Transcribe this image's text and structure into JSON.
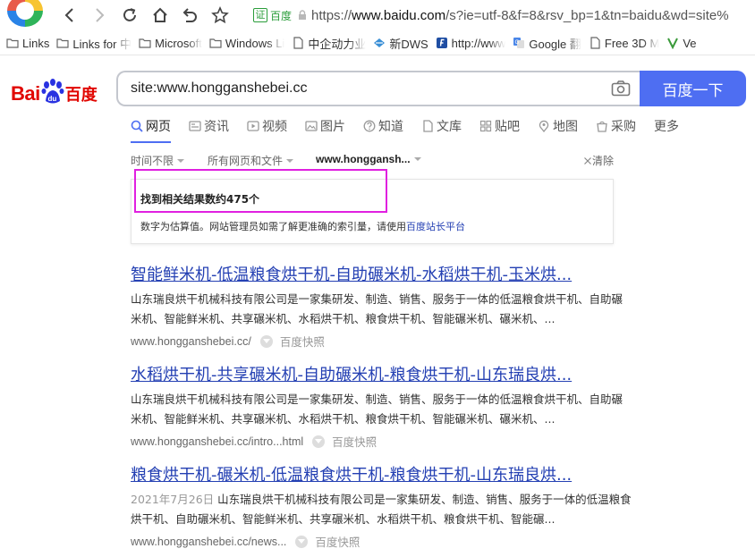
{
  "browser": {
    "cert_label": "证 百度",
    "url_prefix": "https://",
    "url_host": "www.baidu.com",
    "url_rest": "/s?ie=utf-8&f=8&rsv_bp=1&tn=baidu&wd=site%"
  },
  "bookmarks": [
    "Links",
    "Links for 中",
    "Microsoft",
    "Windows Li",
    "中企动力业",
    "新DWS",
    "http://www",
    "Google 翻",
    "Free 3D M",
    "Ve"
  ],
  "header": {
    "logo_text": "Bai",
    "logo_du": "du",
    "logo_cn": "百度",
    "search_value": "site:www.hongganshebei.cc",
    "search_button": "百度一下"
  },
  "tabs": [
    "网页",
    "资讯",
    "视频",
    "图片",
    "知道",
    "文库",
    "贴吧",
    "地图",
    "采购",
    "更多"
  ],
  "filters": {
    "time": "时间不限",
    "type": "所有网页和文件",
    "site": "www.hongganshebei.cc",
    "site_display": "www.honggansh...",
    "clear": "清除"
  },
  "count_panel": {
    "title": "找到相关结果数约475个",
    "note_prefix": "数字为估算值。网站管理员如需了解更准确的索引量，请使用",
    "note_link": "百度站长平台"
  },
  "results": [
    {
      "title": "智能鲜米机-低温粮食烘干机-自助碾米机-水稻烘干机-玉米烘...",
      "date": "",
      "abstract": "山东瑞良烘干机械科技有限公司是一家集研发、制造、销售、服务于一体的低温粮食烘干机、自助碾米机、智能鲜米机、共享碾米机、水稻烘干机、粮食烘干机、智能碾米机、碾米机、...",
      "url": "www.hongganshebei.cc/",
      "snapshot": "百度快照"
    },
    {
      "title": "水稻烘干机-共享碾米机-自助碾米机-粮食烘干机-山东瑞良烘...",
      "date": "",
      "abstract": "山东瑞良烘干机械科技有限公司是一家集研发、制造、销售、服务于一体的低温粮食烘干机、自助碾米机、智能鲜米机、共享碾米机、水稻烘干机、粮食烘干机、智能碾米机、碾米机、...",
      "url": "www.hongganshebei.cc/intro...html",
      "snapshot": "百度快照"
    },
    {
      "title": "粮食烘干机-碾米机-低温粮食烘干机-粮食烘干机-山东瑞良烘...",
      "date": "2021年7月26日",
      "abstract": "山东瑞良烘干机械科技有限公司是一家集研发、制造、销售、服务于一体的低温粮食烘干机、自助碾米机、智能鲜米机、共享碾米机、水稻烘干机、粮食烘干机、智能碾...",
      "url": "www.hongganshebei.cc/news...",
      "snapshot": "百度快照"
    }
  ],
  "colors": {
    "accent": "#4e6ef2",
    "link": "#2440b3",
    "logo_red": "#e10601",
    "highlight": "#e020e0"
  }
}
